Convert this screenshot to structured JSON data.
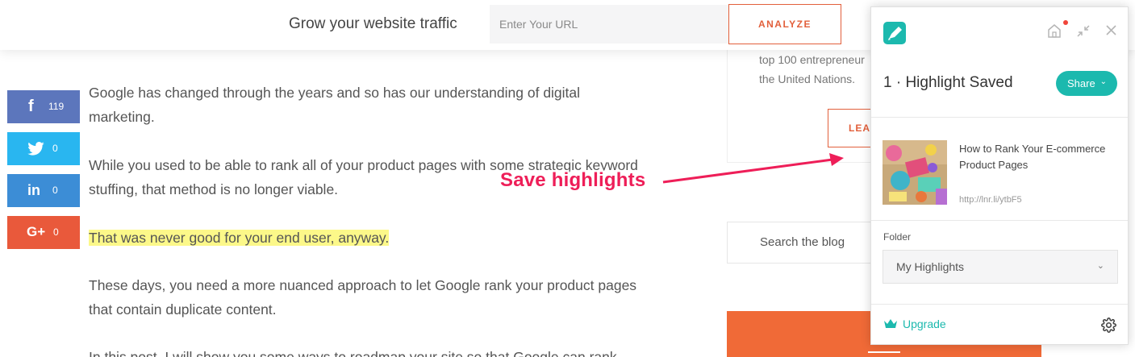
{
  "topbar": {
    "title": "Grow your website traffic",
    "url_placeholder": "Enter Your URL",
    "analyze_label": "ANALYZE"
  },
  "share_buttons": [
    {
      "network": "facebook",
      "icon": "f",
      "count": "119",
      "color": "#5c76bc"
    },
    {
      "network": "twitter",
      "icon": "twitter-bird",
      "count": "0",
      "color": "#29b6f0"
    },
    {
      "network": "linkedin",
      "icon": "in",
      "count": "0",
      "color": "#3c8dd6"
    },
    {
      "network": "google-plus",
      "icon": "G+",
      "count": "0",
      "color": "#e9593b"
    }
  ],
  "article": {
    "paragraphs": [
      "Google has changed through the years and so has our understanding of digital marketing.",
      "While you used to be able to rank all of your product pages with some strategic keyword stuffing, that method is no longer viable.",
      "That was never good for your end user, anyway.",
      "These days, you need a more nuanced approach to let Google rank your product pages that contain duplicate content.",
      "In this post, I will show you some ways to roadmap your site so that Google can rank"
    ],
    "highlight_color": "#fcf889"
  },
  "sidebar": {
    "text": "top 100 entrepreneur the United Nations.",
    "learn_label": "LEA",
    "search_placeholder": "Search the blog",
    "cta_color": "#f06a37"
  },
  "annotation": {
    "text": "Save highlights",
    "color": "#ee1e58"
  },
  "panel": {
    "title": "1 · Highlight Saved",
    "share_label": "Share",
    "accent": "#1cb9ae",
    "item": {
      "title": "How to Rank Your E-commerce Product Pages",
      "link": "http://lnr.li/ytbF5"
    },
    "folder_label": "Folder",
    "folder_value": "My Highlights",
    "upgrade_label": "Upgrade",
    "icons": [
      "logo-icon",
      "home-icon",
      "collapse-icon",
      "close-icon",
      "crown-icon",
      "gear-icon"
    ]
  }
}
